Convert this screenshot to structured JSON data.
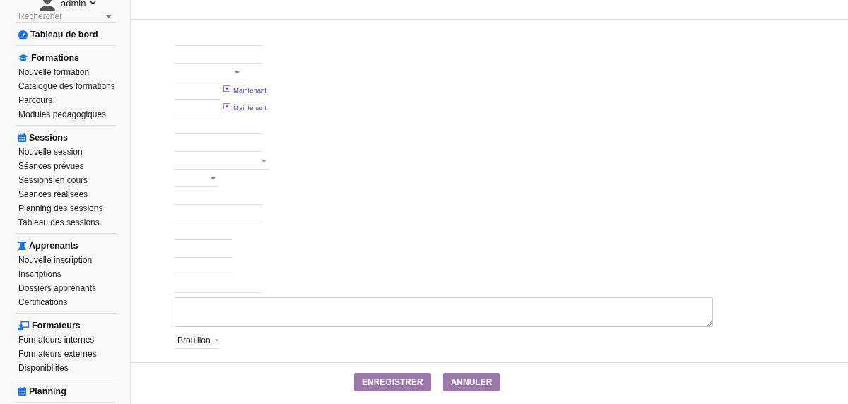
{
  "user": {
    "name": "admin"
  },
  "search": {
    "placeholder": "Rechercher"
  },
  "sidebar": {
    "sections": [
      {
        "kind": "dashboard",
        "title": "Tableau de bord"
      },
      {
        "kind": "graduation",
        "title": "Formations",
        "items": [
          "Nouvelle formation",
          "Catalogue des formations",
          "Parcours",
          "Modules pedagogiques"
        ]
      },
      {
        "kind": "calendar",
        "title": "Sessions",
        "items": [
          "Nouvelle session",
          "Séances prévues",
          "Sessions en cours",
          "Séances réalisées",
          "Planning des sessions",
          "Tableau des sessions"
        ]
      },
      {
        "kind": "student",
        "title": "Apprenants",
        "items": [
          "Nouvelle inscription",
          "Inscriptions",
          "Dossiers apprenants",
          "Certifications"
        ]
      },
      {
        "kind": "teacher",
        "title": "Formateurs",
        "items": [
          "Formateurs internes",
          "Formateurs externes",
          "Disponibilites"
        ]
      },
      {
        "kind": "calendar",
        "title": "Planning"
      }
    ]
  },
  "form": {
    "fields": [
      {
        "kind": "text"
      },
      {
        "kind": "text"
      },
      {
        "kind": "select"
      },
      {
        "kind": "datetime",
        "link": "Maintenant"
      },
      {
        "kind": "datetime",
        "link": "Maintenant"
      },
      {
        "kind": "text"
      },
      {
        "kind": "text"
      },
      {
        "kind": "wide-select"
      },
      {
        "kind": "small-select"
      },
      {
        "kind": "text"
      },
      {
        "kind": "text"
      },
      {
        "kind": "short-text"
      },
      {
        "kind": "short-text"
      },
      {
        "kind": "short-text"
      },
      {
        "kind": "text"
      },
      {
        "kind": "textarea"
      },
      {
        "kind": "status-select",
        "value": "Brouillon"
      }
    ]
  },
  "buttons": [
    "ENREGISTRER",
    "ANNULER"
  ]
}
